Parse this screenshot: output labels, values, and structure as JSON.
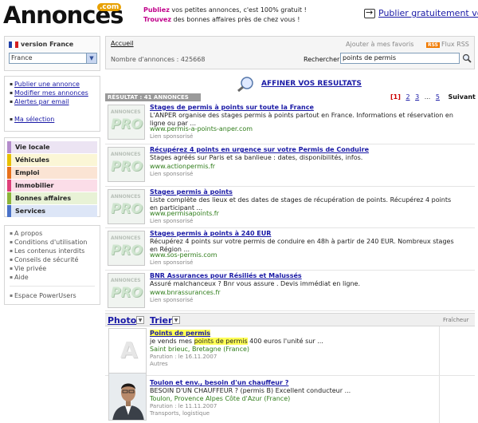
{
  "header": {
    "logo_text": "Annonces",
    "logo_suffix": ".com",
    "tagline1_bold": "Publiez",
    "tagline1_rest": " vos petites annonces, c'est 100% gratuit !",
    "tagline2_bold": "Trouvez",
    "tagline2_rest": " des bonnes affaires près de chez vous !",
    "publish_label": "Publier gratuitement vo"
  },
  "sidebar": {
    "version_label": "version France",
    "country_value": "France",
    "actions": [
      "Publier une annonce",
      "Modifier mes annonces",
      "Alertes par email"
    ],
    "selection_label": "Ma sélection",
    "categories": [
      {
        "label": "Vie locale",
        "color": "#b48ccc",
        "bg": "#ece4f3"
      },
      {
        "label": "Véhicules",
        "color": "#e8c000",
        "bg": "#fbf6d6"
      },
      {
        "label": "Emploi",
        "color": "#e8701a",
        "bg": "#fbe4d4"
      },
      {
        "label": "Immobilier",
        "color": "#e0407a",
        "bg": "#fbdde8"
      },
      {
        "label": "Bonnes affaires",
        "color": "#8cb43a",
        "bg": "#e8f2d6"
      },
      {
        "label": "Services",
        "color": "#4a72c8",
        "bg": "#dde6f7"
      }
    ],
    "aux": [
      "A propos",
      "Conditions d'utilisation",
      "Les contenus interdits",
      "Conseils de sécurité",
      "Vie privée",
      "Aide"
    ],
    "poweruser": "Espace PowerUsers"
  },
  "topbar": {
    "home": "Accueil",
    "favorite": "Ajouter à mes favoris",
    "rss_badge": "RSS",
    "rss": "Flux RSS",
    "count_label": "Nombre d'annonces : 425668",
    "search_label": "Rechercher",
    "search_value": "points de permis"
  },
  "refine_label": "AFFINER VOS RESULTATS",
  "results": {
    "label": "RÉSULTAT : 41 ANNONCES",
    "pages": [
      "1",
      "2",
      "3",
      "...",
      "5"
    ],
    "next": "Suivant"
  },
  "pro_badge": {
    "top": "ANNONCES",
    "main": "PRO"
  },
  "sponsored": [
    {
      "title": "Stages de permis à points sur toute la France",
      "desc": "L'ANPER organise des stages permis à points partout en France. Informations et réservation en ligne ou par ...",
      "url": "www.permis-a-points-anper.com",
      "note": "Lien sponsorisé"
    },
    {
      "title": "Récupérez 4 points en urgence sur votre Permis de Conduire",
      "desc": "Stages agréés sur Paris et sa banlieue : dates, disponibilités, infos.",
      "url": "www.actionpermis.fr",
      "note": "Lien sponsorisé"
    },
    {
      "title": "Stages permis à points",
      "desc": "Liste complète des lieux et des dates de stages de récupération de points. Récupérez 4 points en participant ...",
      "url": "www.permisapoints.fr",
      "note": "Lien sponsorisé"
    },
    {
      "title": "Stages permis à points à 240 EUR",
      "desc": "Récupérez 4 points sur votre permis de conduire en 48h à partir de 240 EUR. Nombreux stages en Région ...",
      "url": "www.sos-permis.com",
      "note": "Lien sponsorisé"
    },
    {
      "title": "BNR Assurances pour Résiliés et Malussés",
      "desc": "Assuré malchanceux ? Bnr vous assure . Devis immédiat en ligne.",
      "url": "www.bnrassurances.fr",
      "note": "Lien sponsorisé"
    }
  ],
  "columns": {
    "photo": "Photo",
    "sort": "Trier",
    "freshness": "Fraîcheur"
  },
  "listings": [
    {
      "title": "Points de permis",
      "desc_before": "je vends mes ",
      "desc_hl": "points de permis",
      "desc_after": " 400 euros l'unité sur ...",
      "location": "Saint brieuc, Bretagne (France)",
      "date": "Parution : le 16.11.2007",
      "category": "Autres",
      "placeholder_letter": "A"
    },
    {
      "title": "Toulon et env., besoin d'un chauffeur ?",
      "desc_before": "BESOIN D'UN CHAUFFEUR ? (permis B) Excellent conducteur ...",
      "desc_hl": "",
      "desc_after": "",
      "location": "Toulon, Provence Alpes Côte d'Azur (France)",
      "date": "Parution : le 11.11.2007",
      "category": "Transports, logistique"
    }
  ]
}
